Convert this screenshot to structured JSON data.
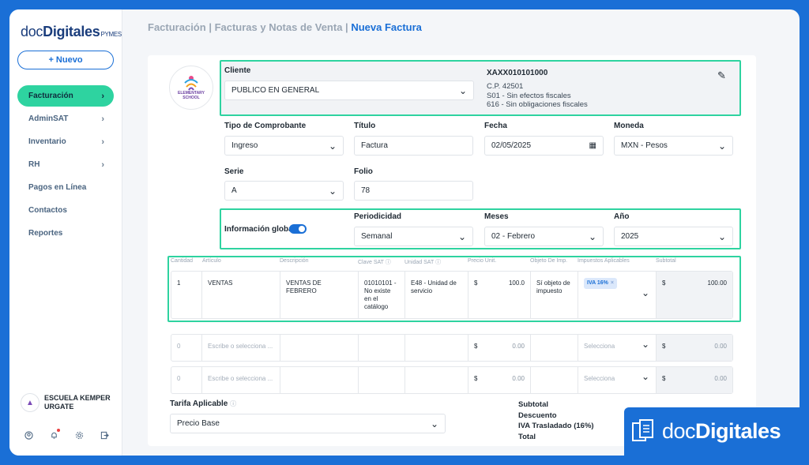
{
  "sidebar": {
    "logo_main": "doc",
    "logo_bold": "Digitales",
    "logo_sub": "PYMES",
    "new_button": "+ Nuevo",
    "items": [
      {
        "label": "Facturación",
        "has_chevron": true,
        "active": true
      },
      {
        "label": "AdminSAT",
        "has_chevron": true
      },
      {
        "label": "Inventario",
        "has_chevron": true
      },
      {
        "label": "RH",
        "has_chevron": true
      },
      {
        "label": "Pagos en Línea",
        "has_chevron": false
      },
      {
        "label": "Contactos",
        "has_chevron": false
      },
      {
        "label": "Reportes",
        "has_chevron": false
      }
    ],
    "user_name_line1": "ESCUELA KEMPER",
    "user_name_line2": "URGATE",
    "bottom_icons": [
      "user-circle-icon",
      "bell-icon",
      "gear-icon",
      "logout-icon"
    ]
  },
  "breadcrumb": {
    "part1": "Facturación",
    "sep1": "|",
    "part2": "Facturas y Notas de Venta",
    "sep2": "|",
    "current": "Nueva Factura"
  },
  "school_logo": {
    "line1": "ELEMENTARY",
    "line2": "SCHOOL"
  },
  "cliente": {
    "label": "Cliente",
    "value": "PUBLICO EN GENERAL",
    "rfc": "XAXX010101000",
    "cp": "C.P. 42501",
    "regimen": "S01 - Sin efectos fiscales",
    "uso": "616 - Sin obligaciones fiscales"
  },
  "fields": {
    "tipo_label": "Tipo de Comprobante",
    "tipo_value": "Ingreso",
    "titulo_label": "Título",
    "titulo_value": "Factura",
    "fecha_label": "Fecha",
    "fecha_value": "02/05/2025",
    "moneda_label": "Moneda",
    "moneda_value": "MXN - Pesos",
    "serie_label": "Serie",
    "serie_value": "A",
    "folio_label": "Folio",
    "folio_value": "78"
  },
  "global_info": {
    "label": "Información global",
    "toggle_on": true,
    "periodicidad_label": "Periodicidad",
    "periodicidad_value": "Semanal",
    "meses_label": "Meses",
    "meses_value": "02 - Febrero",
    "anio_label": "Año",
    "anio_value": "2025"
  },
  "table": {
    "headers": [
      "Cantidad",
      "Artículo",
      "Descripción",
      "Clave SAT",
      "Unidad SAT",
      "Precio Unit.",
      "Objeto De Imp.",
      "Impuestos Aplicables",
      "Subtotal"
    ],
    "row1": {
      "cantidad": "1",
      "articulo": "VENTAS",
      "descripcion": "VENTAS DE FEBRERO",
      "clave": "01010101 - No existe en el catálogo",
      "unidad": "E48 - Unidad de servicio",
      "currency": "$",
      "precio": "100.0",
      "objeto": "Sí objeto de impuesto",
      "impuesto_badge": "IVA 16%",
      "subtotal": "100.00"
    },
    "empty_rows": [
      {
        "cantidad": "0",
        "articulo_placeholder": "Escribe o selecciona ...",
        "currency": "$",
        "precio": "0.00",
        "impuestos_placeholder": "Selecciona",
        "subtotal": "0.00"
      },
      {
        "cantidad": "0",
        "articulo_placeholder": "Escribe o selecciona ...",
        "currency": "$",
        "precio": "0.00",
        "impuestos_placeholder": "Selecciona",
        "subtotal": "0.00"
      }
    ]
  },
  "tarifa": {
    "label": "Tarifa Aplicable",
    "value": "Precio Base"
  },
  "totals": {
    "subtotal": "Subtotal",
    "descuento": "Descuento",
    "iva": "IVA Trasladado (16%)",
    "total": "Total"
  },
  "brand": {
    "doc": "doc",
    "digitales": "Digitales"
  },
  "colors": {
    "accent": "#1a6fd6",
    "highlight": "#2ed3a0",
    "background": "#1a6fd6"
  }
}
